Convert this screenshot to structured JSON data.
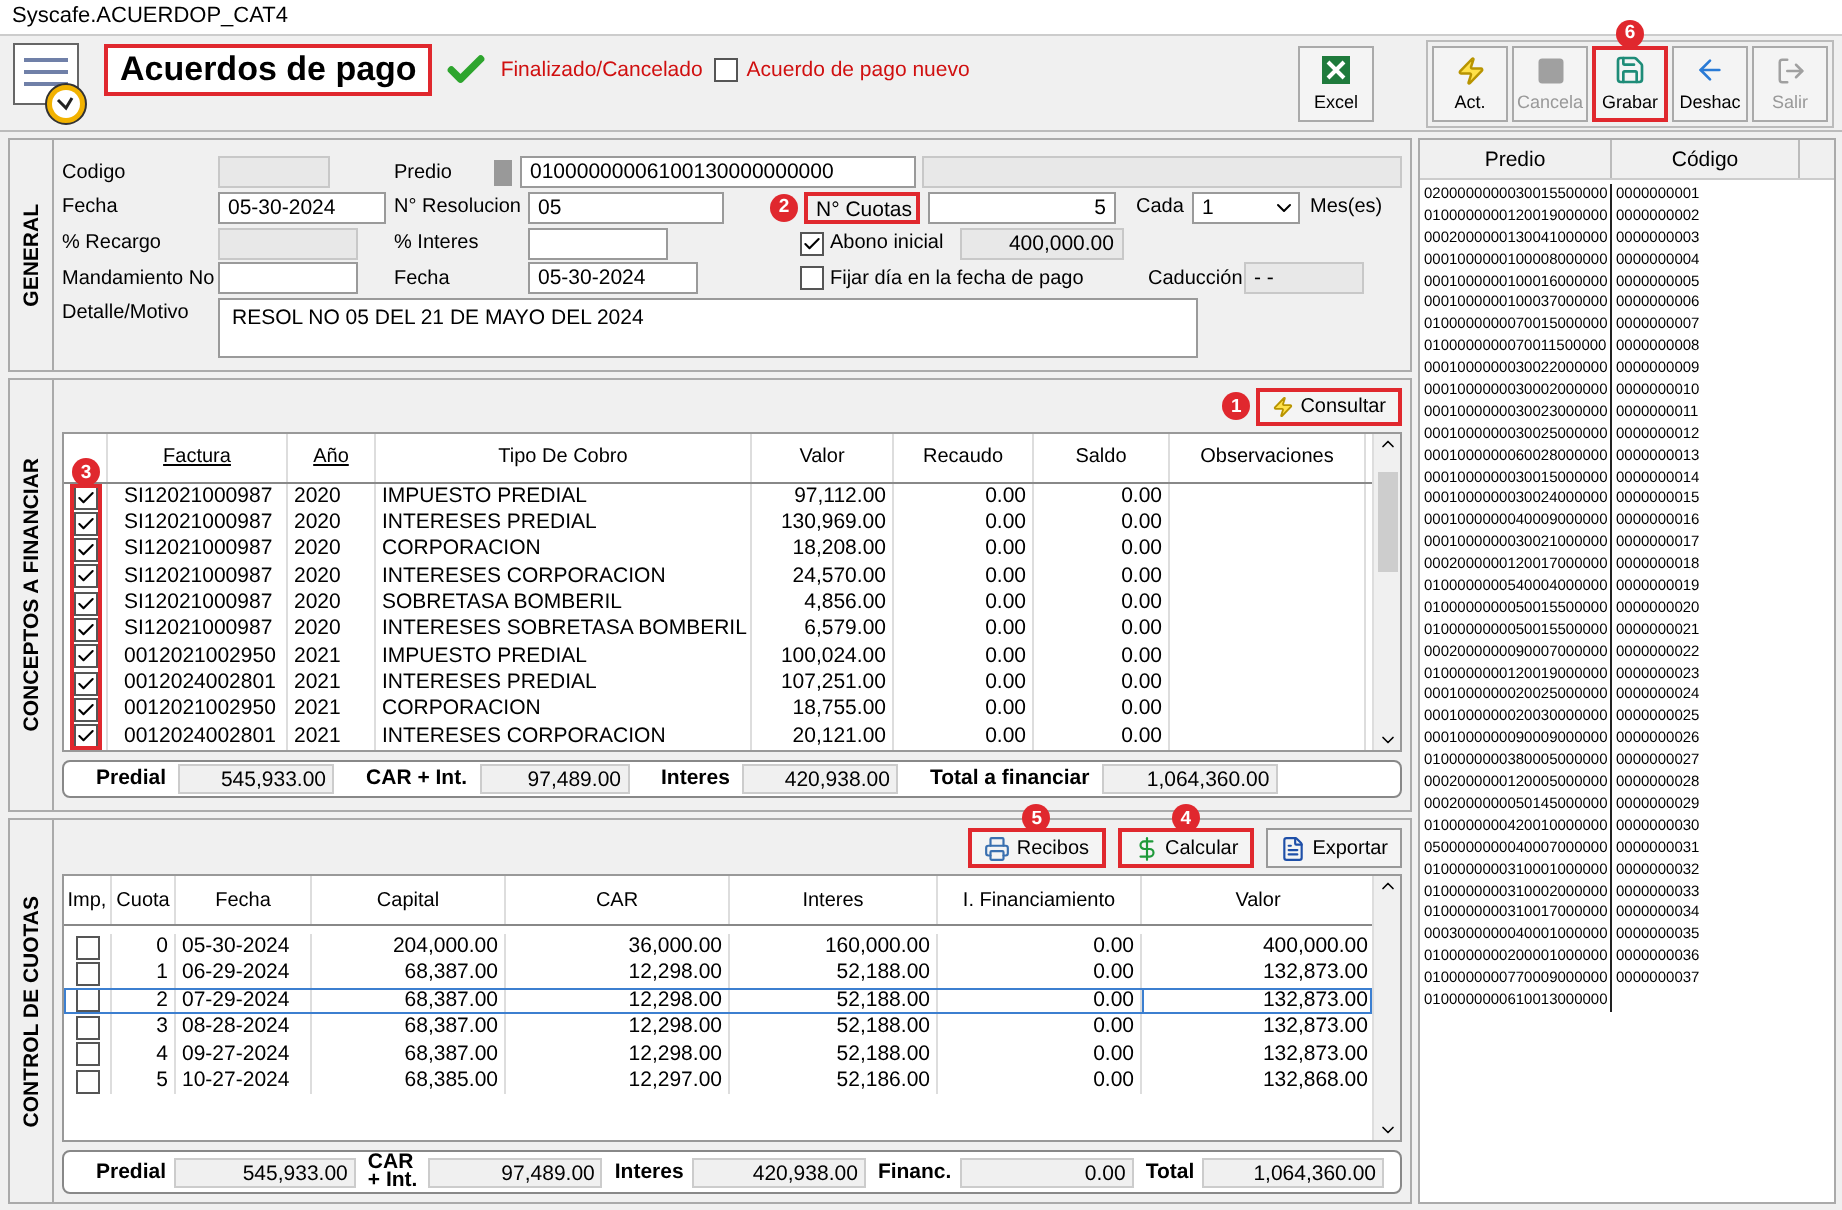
{
  "window": {
    "title": "Syscafe.ACUERDOP_CAT4"
  },
  "header": {
    "title": "Acuerdos de pago",
    "title_highlighted": true,
    "finalized": true,
    "status": "Finalizado/Cancelado",
    "new_agreement": {
      "label": "Acuerdo de pago nuevo",
      "checked": false
    }
  },
  "toolbar": [
    {
      "label": "Excel",
      "kind": "excel",
      "disabled": false,
      "highlighted": false
    },
    {
      "label": "Act.",
      "kind": "bolt",
      "disabled": false,
      "highlighted": false
    },
    {
      "label": "Cancela",
      "kind": "stop",
      "disabled": true,
      "highlighted": false
    },
    {
      "label": "Grabar",
      "kind": "save",
      "disabled": false,
      "highlighted": true,
      "badge": "6"
    },
    {
      "label": "Deshac",
      "kind": "undo",
      "disabled": false,
      "highlighted": false
    },
    {
      "label": "Salir",
      "kind": "exit",
      "disabled": true,
      "highlighted": false
    }
  ],
  "general": {
    "section_label": "GENERAL",
    "codigo": {
      "label": "Codigo",
      "disabled": true
    },
    "predio": {
      "label": "Predio",
      "value": "01000000006100130000000000"
    },
    "fecha": {
      "label": "Fecha",
      "value": "05-30-2024"
    },
    "resolucion": {
      "label": "N° Resolucion",
      "value": "05"
    },
    "cuotas": {
      "label": "N° Cuotas",
      "value": "5",
      "highlighted": true,
      "badge": "2"
    },
    "cada": {
      "label": "Cada",
      "value": "1",
      "unit": "Mes(es)"
    },
    "recargo": {
      "label": "% Recargo",
      "disabled": true
    },
    "interes": {
      "label": "% Interes",
      "disabled": false
    },
    "abono": {
      "label": "Abono inicial",
      "checked": true,
      "value": "400,000.00"
    },
    "mandamiento": {
      "label": "Mandamiento No",
      "disabled": false
    },
    "fecha_resolucion": {
      "label": "Fecha",
      "value": "05-30-2024"
    },
    "fijar": {
      "label": "Fijar día en la fecha de pago",
      "checked": false
    },
    "caducidad": {
      "label": "Caducción",
      "value": "- -"
    },
    "detalle": {
      "label": "Detalle/Motivo",
      "value": "RESOL NO 05 DEL 21 DE MAYO DEL 2024"
    }
  },
  "conceptos": {
    "section_label": "CONCEPTOS A FINANCIAR",
    "consultar": {
      "label": "Consultar",
      "highlighted": true,
      "badge": "1"
    },
    "check_column": {
      "highlighted": true,
      "badge": "3"
    },
    "columns": [
      {
        "label": "Factura",
        "sortable": true
      },
      {
        "label": "Año",
        "sortable": true
      },
      {
        "label": "Tipo De Cobro",
        "sortable": false
      },
      {
        "label": "Valor",
        "sortable": false
      },
      {
        "label": "Recaudo",
        "sortable": false
      },
      {
        "label": "Saldo",
        "sortable": false
      },
      {
        "label": "Observaciones",
        "sortable": false
      }
    ],
    "rows": [
      {
        "checked": true,
        "cells": [
          "SI12021000987",
          "2020",
          "IMPUESTO PREDIAL",
          "97,112.00",
          "0.00",
          "0.00"
        ]
      },
      {
        "checked": true,
        "cells": [
          "SI12021000987",
          "2020",
          "INTERESES PREDIAL",
          "130,969.00",
          "0.00",
          "0.00"
        ]
      },
      {
        "checked": true,
        "cells": [
          "SI12021000987",
          "2020",
          "CORPORACION",
          "18,208.00",
          "0.00",
          "0.00"
        ]
      },
      {
        "checked": true,
        "cells": [
          "SI12021000987",
          "2020",
          "INTERESES CORPORACION",
          "24,570.00",
          "0.00",
          "0.00"
        ]
      },
      {
        "checked": true,
        "cells": [
          "SI12021000987",
          "2020",
          "SOBRETASA BOMBERIL",
          "4,856.00",
          "0.00",
          "0.00"
        ]
      },
      {
        "checked": true,
        "cells": [
          "SI12021000987",
          "2020",
          "INTERESES SOBRETASA BOMBERIL",
          "6,579.00",
          "0.00",
          "0.00"
        ]
      },
      {
        "checked": true,
        "cells": [
          "0012021002950",
          "2021",
          "IMPUESTO PREDIAL",
          "100,024.00",
          "0.00",
          "0.00"
        ]
      },
      {
        "checked": true,
        "cells": [
          "0012024002801",
          "2021",
          "INTERESES PREDIAL",
          "107,251.00",
          "0.00",
          "0.00"
        ]
      },
      {
        "checked": true,
        "cells": [
          "0012021002950",
          "2021",
          "CORPORACION",
          "18,755.00",
          "0.00",
          "0.00"
        ]
      },
      {
        "checked": true,
        "cells": [
          "0012024002801",
          "2021",
          "INTERESES CORPORACION",
          "20,121.00",
          "0.00",
          "0.00"
        ]
      }
    ],
    "totals": [
      {
        "label": "Predial",
        "value": "545,933.00"
      },
      {
        "label": "CAR + Int.",
        "value": "97,489.00"
      },
      {
        "label": "Interes",
        "value": "420,938.00"
      },
      {
        "label": "Total a financiar",
        "value": "1,064,360.00"
      }
    ]
  },
  "cuotas": {
    "section_label": "CONTROL DE CUOTAS",
    "buttons": [
      {
        "label": "Recibos",
        "kind": "print",
        "highlighted": true,
        "badge": "5"
      },
      {
        "label": "Calcular",
        "kind": "money",
        "highlighted": true,
        "badge": "4"
      },
      {
        "label": "Exportar",
        "kind": "word",
        "highlighted": false
      }
    ],
    "check_column": "Imp,",
    "columns": [
      "Cuota",
      "Fecha",
      "Capital",
      "CAR",
      "Interes",
      "I. Financiamiento",
      "Valor"
    ],
    "rows": [
      {
        "imp": false,
        "selected": false,
        "cells": [
          "0",
          "05-30-2024",
          "204,000.00",
          "36,000.00",
          "160,000.00",
          "0.00",
          "400,000.00"
        ]
      },
      {
        "imp": false,
        "selected": false,
        "cells": [
          "1",
          "06-29-2024",
          "68,387.00",
          "12,298.00",
          "52,188.00",
          "0.00",
          "132,873.00"
        ]
      },
      {
        "imp": false,
        "selected": true,
        "cells": [
          "2",
          "07-29-2024",
          "68,387.00",
          "12,298.00",
          "52,188.00",
          "0.00",
          "132,873.00"
        ]
      },
      {
        "imp": false,
        "selected": false,
        "cells": [
          "3",
          "08-28-2024",
          "68,387.00",
          "12,298.00",
          "52,188.00",
          "0.00",
          "132,873.00"
        ]
      },
      {
        "imp": false,
        "selected": false,
        "cells": [
          "4",
          "09-27-2024",
          "68,387.00",
          "12,298.00",
          "52,188.00",
          "0.00",
          "132,873.00"
        ]
      },
      {
        "imp": false,
        "selected": false,
        "cells": [
          "5",
          "10-27-2024",
          "68,385.00",
          "12,297.00",
          "52,186.00",
          "0.00",
          "132,868.00"
        ]
      }
    ],
    "totals": [
      {
        "label": "Predial",
        "value": "545,933.00"
      },
      {
        "label": "CAR + Int.",
        "value": "97,489.00"
      },
      {
        "label": "Interes",
        "value": "420,938.00"
      },
      {
        "label": "Financ.",
        "value": "0.00"
      },
      {
        "label": "Total",
        "value": "1,064,360.00"
      }
    ]
  },
  "predios": {
    "columns": [
      "Predio",
      "Código"
    ],
    "rows": [
      {
        "predio": "0200000000030015500000",
        "codigo": "0000000001"
      },
      {
        "predio": "0100000000120019000000",
        "codigo": "0000000002"
      },
      {
        "predio": "0002000000130041000000",
        "codigo": "0000000003"
      },
      {
        "predio": "0001000000100008000000",
        "codigo": "0000000004"
      },
      {
        "predio": "0001000000100016000000",
        "codigo": "0000000005"
      },
      {
        "predio": "0001000000100037000000",
        "codigo": "0000000006"
      },
      {
        "predio": "0100000000070015000000",
        "codigo": "0000000007"
      },
      {
        "predio": "0100000000070011500000",
        "codigo": "0000000008"
      },
      {
        "predio": "0001000000030022000000",
        "codigo": "0000000009"
      },
      {
        "predio": "0001000000030002000000",
        "codigo": "0000000010"
      },
      {
        "predio": "0001000000030023000000",
        "codigo": "0000000011"
      },
      {
        "predio": "0001000000030025000000",
        "codigo": "0000000012"
      },
      {
        "predio": "0001000000060028000000",
        "codigo": "0000000013"
      },
      {
        "predio": "0001000000030015000000",
        "codigo": "0000000014"
      },
      {
        "predio": "0001000000030024000000",
        "codigo": "0000000015"
      },
      {
        "predio": "0001000000040009000000",
        "codigo": "0000000016"
      },
      {
        "predio": "0001000000030021000000",
        "codigo": "0000000017"
      },
      {
        "predio": "0002000000120017000000",
        "codigo": "0000000018"
      },
      {
        "predio": "0100000000540004000000",
        "codigo": "0000000019"
      },
      {
        "predio": "0100000000050015500000",
        "codigo": "0000000020"
      },
      {
        "predio": "0100000000050015500000",
        "codigo": "0000000021"
      },
      {
        "predio": "0002000000090007000000",
        "codigo": "0000000022"
      },
      {
        "predio": "0100000000120019000000",
        "codigo": "0000000023"
      },
      {
        "predio": "0001000000020025000000",
        "codigo": "0000000024"
      },
      {
        "predio": "0001000000020030000000",
        "codigo": "0000000025"
      },
      {
        "predio": "0001000000090009000000",
        "codigo": "0000000026"
      },
      {
        "predio": "0100000000380005000000",
        "codigo": "0000000027"
      },
      {
        "predio": "0002000000120005000000",
        "codigo": "0000000028"
      },
      {
        "predio": "0002000000050145000000",
        "codigo": "0000000029"
      },
      {
        "predio": "0100000000420010000000",
        "codigo": "0000000030"
      },
      {
        "predio": "0500000000040007000000",
        "codigo": "0000000031"
      },
      {
        "predio": "0100000000310001000000",
        "codigo": "0000000032"
      },
      {
        "predio": "0100000000310002000000",
        "codigo": "0000000033"
      },
      {
        "predio": "0100000000310017000000",
        "codigo": "0000000034"
      },
      {
        "predio": "0003000000040001000000",
        "codigo": "0000000035"
      },
      {
        "predio": "0100000000200001000000",
        "codigo": "0000000036"
      },
      {
        "predio": "0100000000770009000000",
        "codigo": "0000000037"
      },
      {
        "predio": "0100000000610013000000"
      }
    ]
  }
}
